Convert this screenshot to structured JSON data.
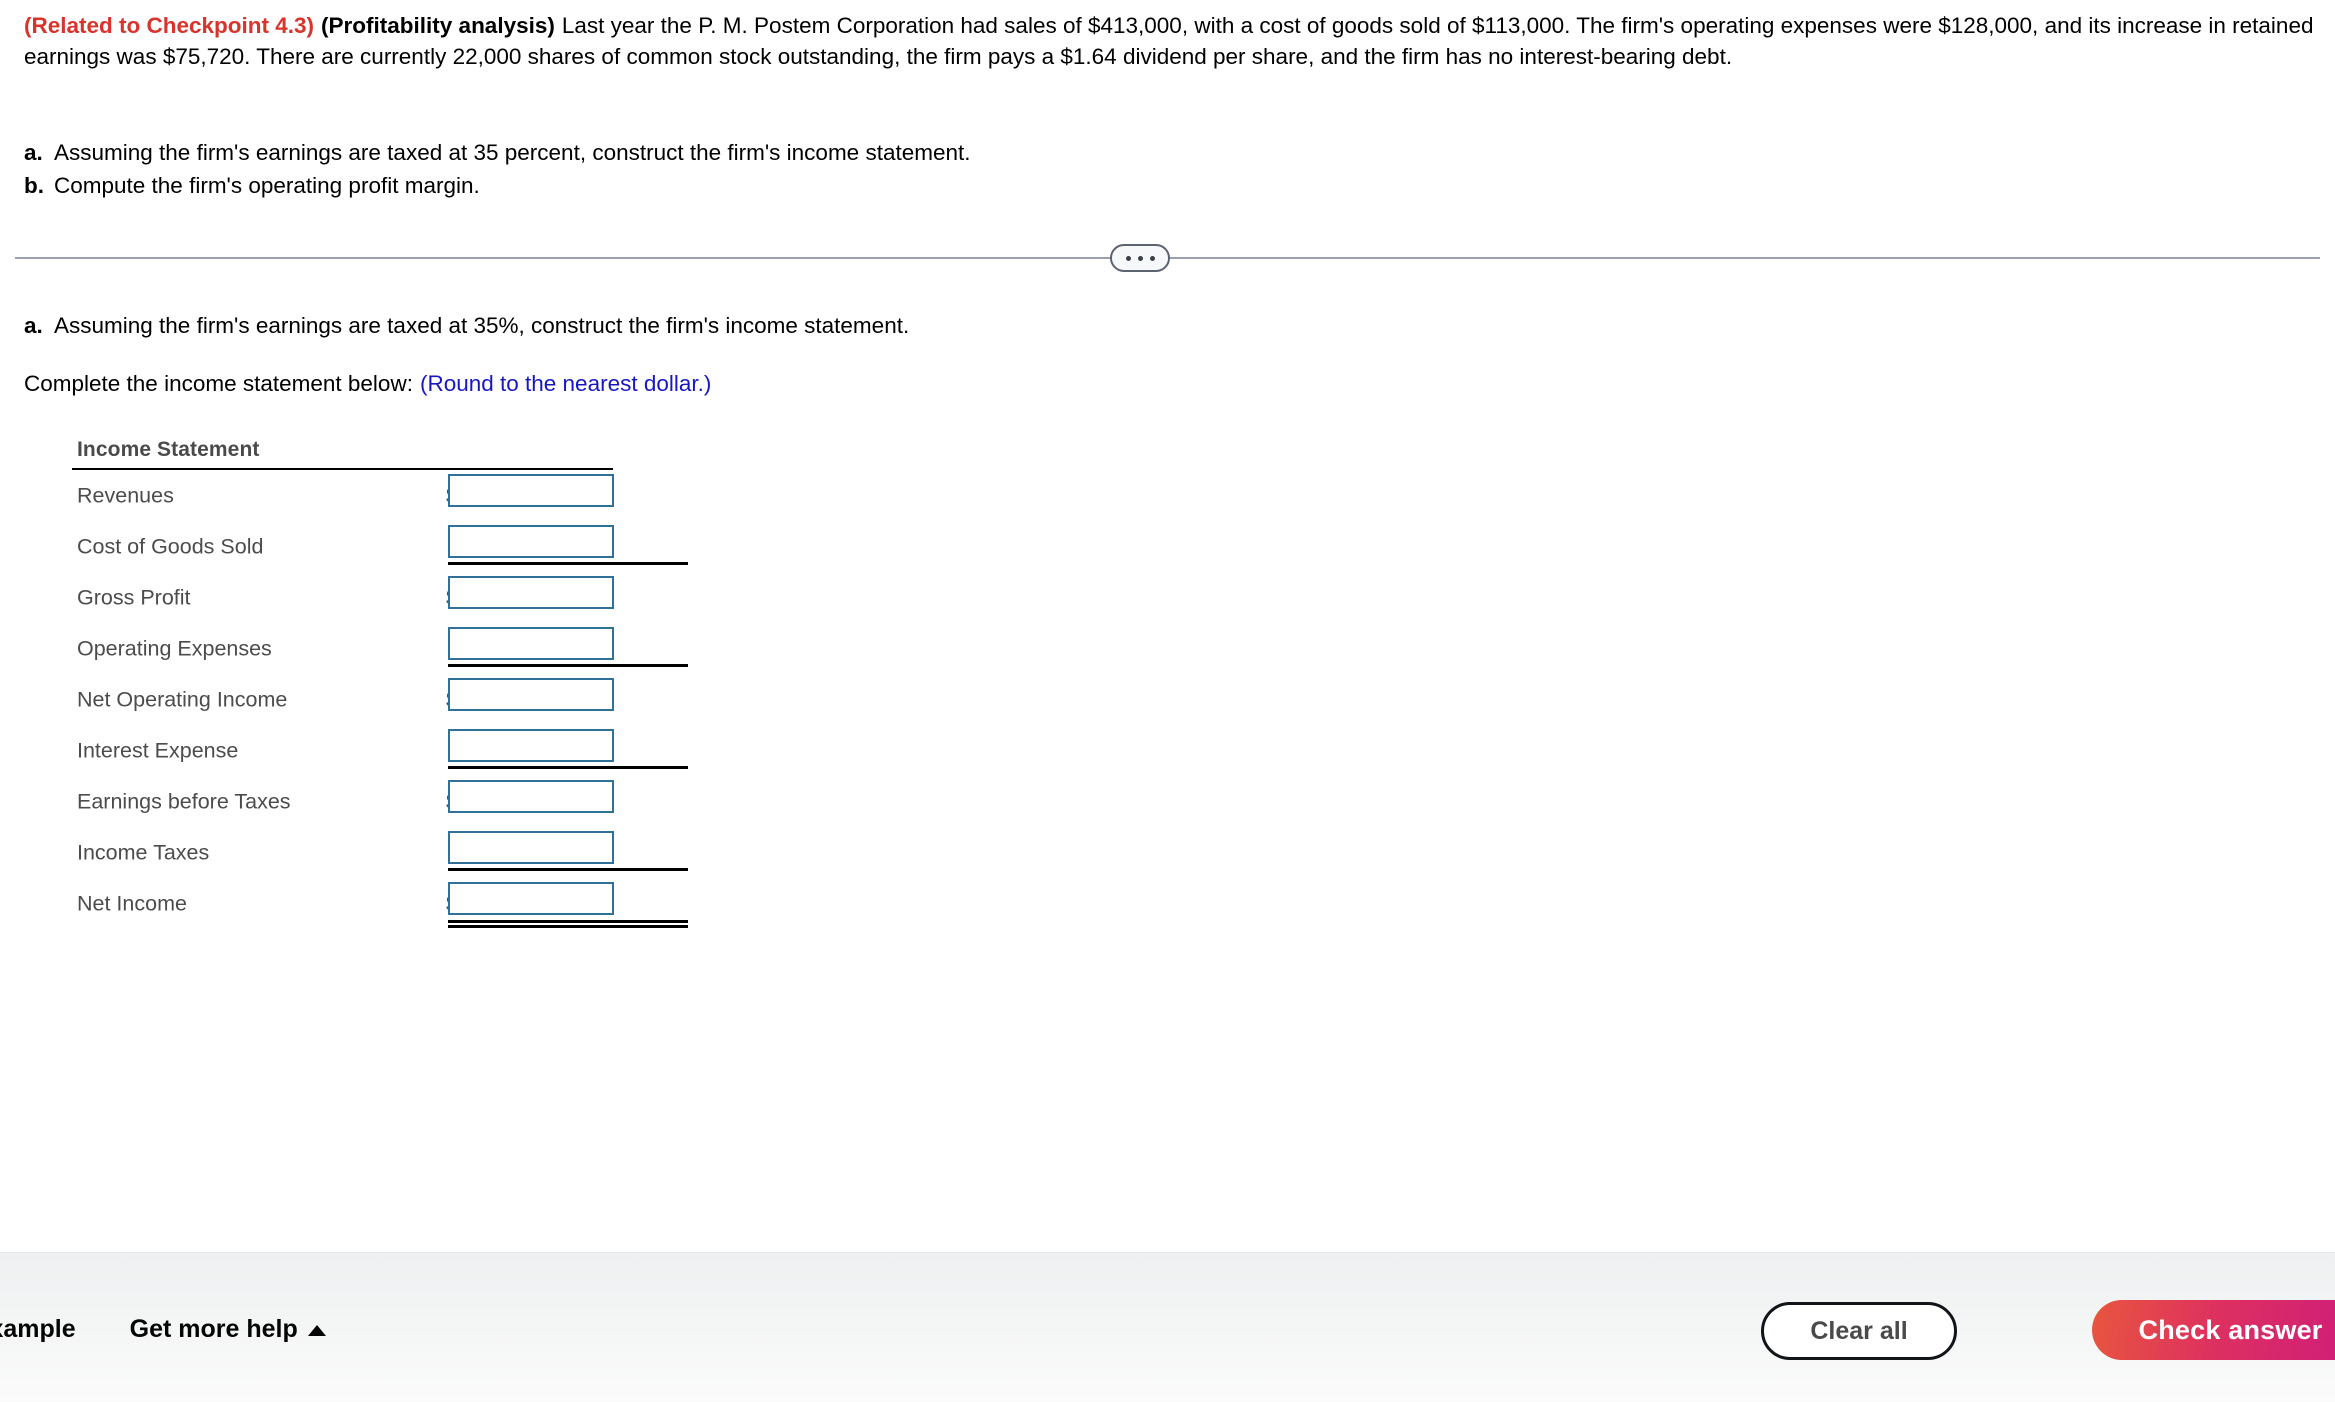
{
  "problem": {
    "checkpoint_ref": "(Related to Checkpoint 4.3)",
    "topic": "(Profitability analysis)",
    "body": "Last year the P. M. Postem Corporation had sales of $413,000, with a cost of goods sold of $113,000.  The firm's operating expenses were $128,000, and its increase in retained earnings was $75,720.  There are currently 22,000 shares of common stock outstanding, the firm pays a $1.64 dividend per share, and the firm has no interest-bearing debt.",
    "parts": [
      {
        "letter": "a.",
        "text": "Assuming the firm's earnings are taxed at 35 percent, construct the firm's income statement."
      },
      {
        "letter": "b.",
        "text": "Compute the firm's operating profit margin."
      }
    ]
  },
  "divider": {
    "ellipsis_label": "..."
  },
  "sub_question": {
    "letter": "a.",
    "text": "Assuming the firm's earnings are taxed at 35%, construct the firm's income statement.",
    "instruction": "Complete the income statement below:",
    "round_note": "(Round to the nearest dollar.)"
  },
  "income_statement": {
    "title": "Income Statement",
    "currency_symbol": "$",
    "rows": [
      {
        "label": "Revenues",
        "dollar": true,
        "value": "",
        "rule": "none"
      },
      {
        "label": "Cost of Goods Sold",
        "dollar": false,
        "value": "",
        "rule": "single"
      },
      {
        "label": "Gross Profit",
        "dollar": true,
        "value": "",
        "rule": "none"
      },
      {
        "label": "Operating Expenses",
        "dollar": false,
        "value": "",
        "rule": "single"
      },
      {
        "label": "Net Operating Income",
        "dollar": true,
        "value": "",
        "rule": "none"
      },
      {
        "label": "Interest Expense",
        "dollar": false,
        "value": "",
        "rule": "single"
      },
      {
        "label": "Earnings before Taxes",
        "dollar": true,
        "value": "",
        "rule": "none"
      },
      {
        "label": "Income Taxes",
        "dollar": false,
        "value": "",
        "rule": "single"
      },
      {
        "label": "Net Income",
        "dollar": true,
        "value": "",
        "rule": "double"
      }
    ]
  },
  "footer": {
    "view_example_label": "View an example",
    "get_more_help_label": "Get more help",
    "clear_all_label": "Clear all",
    "check_answer_label": "Check answer"
  },
  "colors": {
    "checkpoint_red": "#d9342b",
    "round_note_blue": "#1717c4",
    "input_border": "#2f7199",
    "check_answer_start": "#e8563e",
    "check_answer_end": "#cd1b7d",
    "divider_gray": "#99a0ad"
  }
}
